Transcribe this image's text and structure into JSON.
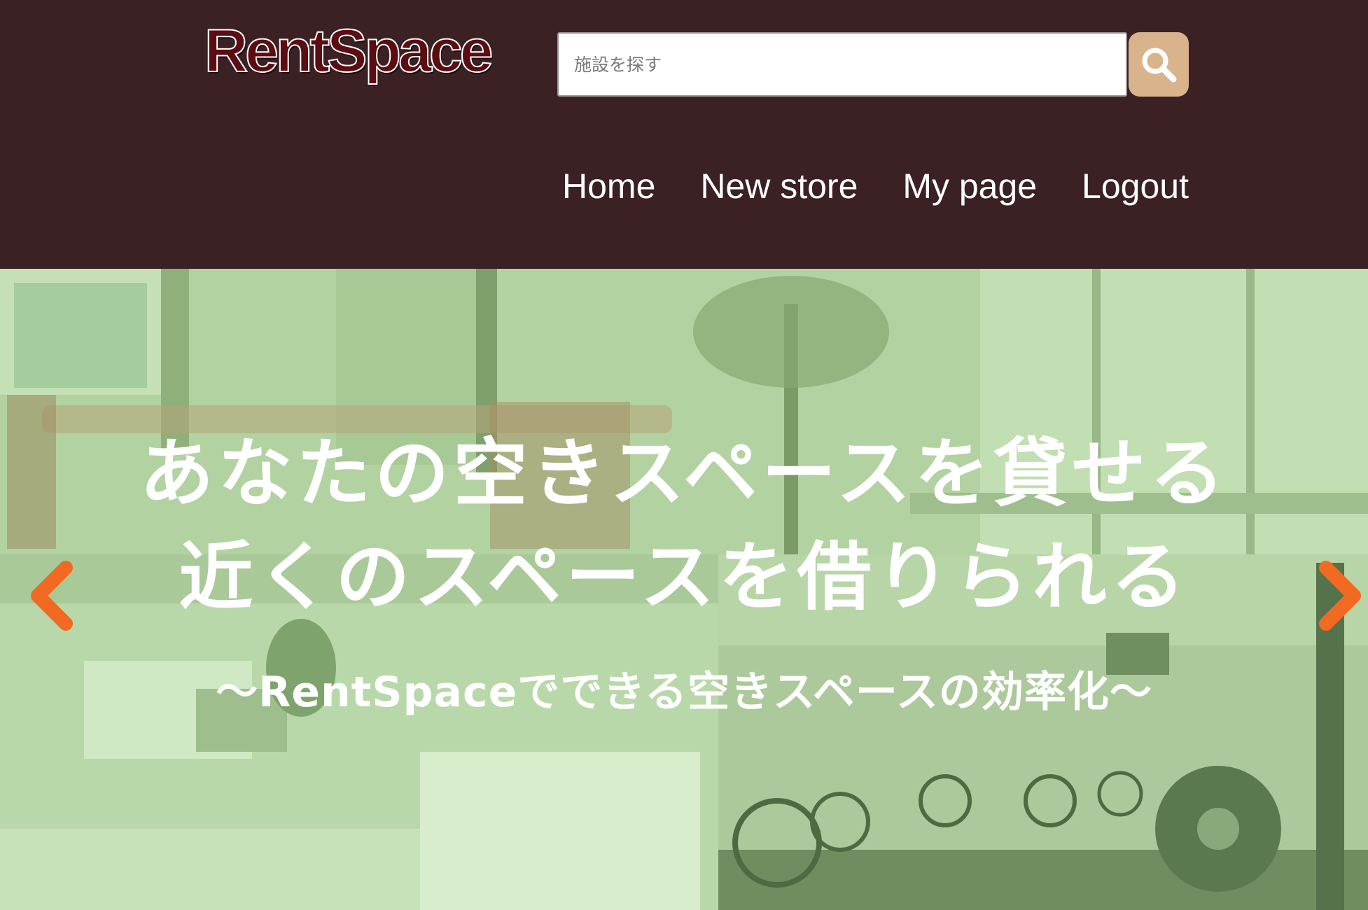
{
  "brand": {
    "logo_text": "RentSpace",
    "logo_color": "#5c0d12"
  },
  "header": {
    "background": "#3b2124"
  },
  "search": {
    "placeholder": "施設を探す",
    "value": "",
    "button_color": "#d9b38c",
    "button_icon": "search-icon"
  },
  "nav": {
    "items": [
      {
        "label": "Home"
      },
      {
        "label": "New store"
      },
      {
        "label": "My page"
      },
      {
        "label": "Logout"
      }
    ]
  },
  "hero": {
    "title_line1": "あなたの空きスペースを貸せる",
    "title_line2": "近くのスペースを借りられる",
    "subtitle": "〜RentSpaceでできる空きスペースの効率化〜",
    "overlay_color": "#b4d4a3",
    "prev_icon": "chevron-left-icon",
    "next_icon": "chevron-right-icon",
    "arrow_color": "#f26a21"
  }
}
